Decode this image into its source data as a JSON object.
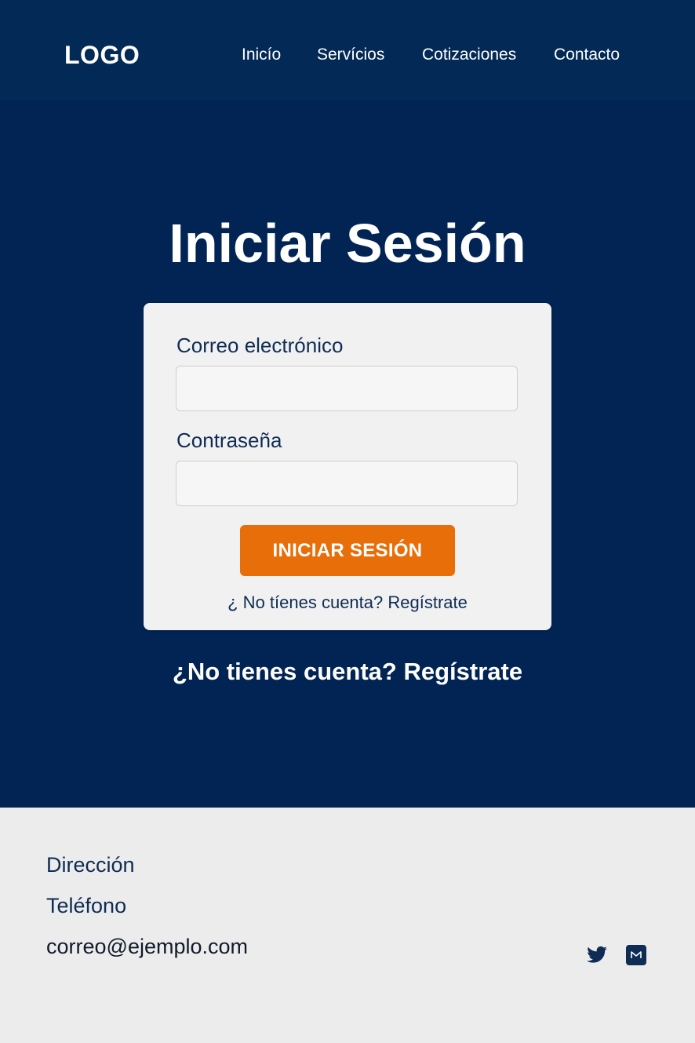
{
  "header": {
    "logo": "LOGO",
    "nav": [
      {
        "label": "Inicío"
      },
      {
        "label": "Servícios"
      },
      {
        "label": "Cotizaciones"
      },
      {
        "label": "Contacto"
      }
    ]
  },
  "main": {
    "title": "Iniciar Sesión",
    "form": {
      "email_label": "Correo electrónico",
      "email_value": "",
      "email_placeholder": "",
      "password_label": "Contraseña",
      "password_value": "",
      "password_placeholder": "",
      "submit_label": "INICIAR SESIÓN",
      "register_link": "¿ No tíenes cuenta? Regístrate"
    },
    "register_link": "¿No tienes cuenta? Regístrate"
  },
  "footer": {
    "address": "Dirección",
    "phone": "Teléfono",
    "email": "correo@ejemplo.com",
    "social": [
      {
        "icon": "twitter-icon"
      },
      {
        "icon": "mail-icon"
      }
    ]
  },
  "colors": {
    "background": "#022454",
    "header": "#032956",
    "card": "#f1f1f1",
    "button": "#e86e09",
    "footer": "#ececec",
    "text_dark": "#0f2c54"
  }
}
